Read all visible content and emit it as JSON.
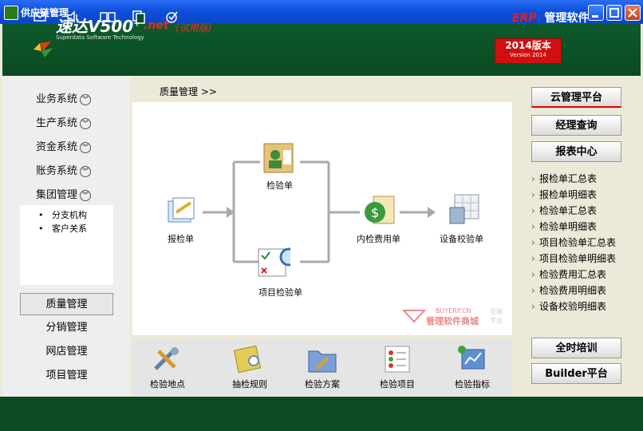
{
  "window": {
    "title": "供应链管理"
  },
  "header": {
    "logo": {
      "main": "速达V500",
      "plus": "+",
      "net": ".net",
      "edition": "(试用版)",
      "sub": "Superdata Software Technology"
    },
    "version": {
      "line1": "2014版本",
      "line2": "Version 2014"
    }
  },
  "leftnav": {
    "systems": [
      {
        "label": "业务系统"
      },
      {
        "label": "生产系统"
      },
      {
        "label": "资金系统"
      },
      {
        "label": "账务系统"
      },
      {
        "label": "集团管理"
      }
    ],
    "group_subitems": [
      {
        "label": "分支机构"
      },
      {
        "label": "客户关系"
      }
    ],
    "modules": [
      {
        "label": "质量管理"
      },
      {
        "label": "分销管理"
      },
      {
        "label": "网店管理"
      },
      {
        "label": "项目管理"
      }
    ]
  },
  "main": {
    "breadcrumb": "质量管理 >>",
    "flow": {
      "nodes": {
        "report": "报检单",
        "inspection": "检验单",
        "project_inspection": "项目检验单",
        "internal_fee": "内检费用单",
        "equipment_cal": "设备校验单"
      },
      "watermark": {
        "site": "BUYERP.CN",
        "name": "管理软件商城",
        "tag1": "至端",
        "tag2": "专业"
      }
    },
    "tools": [
      {
        "label": "检验地点",
        "icon": "tools-icon"
      },
      {
        "label": "抽检规则",
        "icon": "notebook-icon"
      },
      {
        "label": "检验方案",
        "icon": "folder-tools-icon"
      },
      {
        "label": "检验项目",
        "icon": "checklist-icon"
      },
      {
        "label": "检验指标",
        "icon": "indicator-icon"
      }
    ]
  },
  "right": {
    "top_buttons": [
      {
        "label": "云管理平台"
      },
      {
        "label": "经理查询"
      },
      {
        "label": "报表中心"
      }
    ],
    "reports": [
      {
        "label": "报检单汇总表"
      },
      {
        "label": "报检单明细表"
      },
      {
        "label": "检验单汇总表"
      },
      {
        "label": "检验单明细表"
      },
      {
        "label": "项目检验单汇总表"
      },
      {
        "label": "项目检验单明细表"
      },
      {
        "label": "检验费用汇总表"
      },
      {
        "label": "检验费用明细表"
      },
      {
        "label": "设备校验明细表"
      }
    ],
    "bottom_buttons": [
      {
        "label": "全时培训"
      },
      {
        "label": "Builder平台"
      }
    ]
  },
  "footer": {
    "icons": [
      "mail-icon",
      "speaker-icon",
      "book-icon",
      "documents-icon",
      "check-circle-icon"
    ],
    "brand_erp": "ERP",
    "brand_text": "管理软件"
  }
}
